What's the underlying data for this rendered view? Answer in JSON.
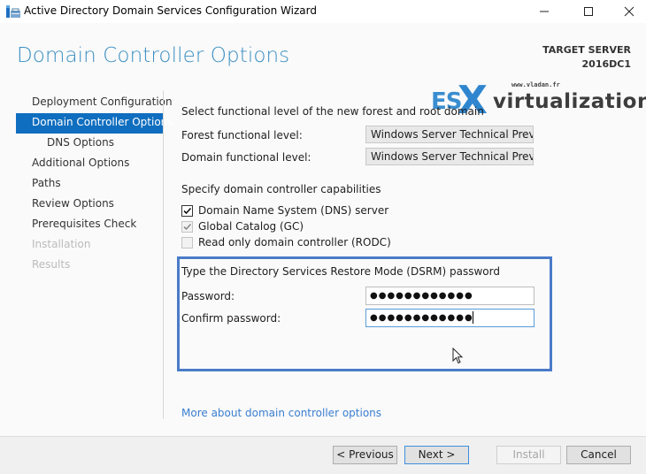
{
  "window": {
    "title": "Active Directory Domain Services Configuration Wizard",
    "controls": {
      "minimize": "minimize",
      "maximize": "maximize",
      "close": "close"
    }
  },
  "header": {
    "page_title": "Domain Controller Options",
    "target_label": "TARGET SERVER",
    "target_value": "2016DC1"
  },
  "watermark": {
    "url": "www.vladan.fr",
    "es": "ES",
    "x": "X",
    "rest": "virtualization"
  },
  "nav": {
    "items": [
      {
        "label": "Deployment Configuration",
        "state": "normal"
      },
      {
        "label": "Domain Controller Options",
        "state": "active"
      },
      {
        "label": "DNS Options",
        "state": "sub"
      },
      {
        "label": "Additional Options",
        "state": "normal"
      },
      {
        "label": "Paths",
        "state": "normal"
      },
      {
        "label": "Review Options",
        "state": "normal"
      },
      {
        "label": "Prerequisites Check",
        "state": "normal"
      },
      {
        "label": "Installation",
        "state": "disabled"
      },
      {
        "label": "Results",
        "state": "disabled"
      }
    ]
  },
  "functional_level": {
    "heading": "Select functional level of the new forest and root domain",
    "forest_label": "Forest functional level:",
    "forest_value": "Windows Server Technical Previe",
    "domain_label": "Domain functional level:",
    "domain_value": "Windows Server Technical Previe"
  },
  "capabilities": {
    "heading": "Specify domain controller capabilities",
    "items": [
      {
        "label": "Domain Name System (DNS) server",
        "checked": true,
        "enabled": true
      },
      {
        "label": "Global Catalog (GC)",
        "checked": true,
        "enabled": false
      },
      {
        "label": "Read only domain controller (RODC)",
        "checked": false,
        "enabled": false
      }
    ]
  },
  "dsrm": {
    "heading": "Type the Directory Services Restore Mode (DSRM) password",
    "password_label": "Password:",
    "password_value": "●●●●●●●●●●●●",
    "confirm_label": "Confirm password:",
    "confirm_value": "●●●●●●●●●●●●"
  },
  "help_link": "More about domain controller options",
  "buttons": {
    "previous": "< Previous",
    "next": "Next >",
    "install": "Install",
    "cancel": "Cancel"
  },
  "colors": {
    "accent": "#0f6ebf",
    "title": "#3a8fc2",
    "link": "#3a7ed0",
    "highlight_box": "#4a7bc8"
  }
}
